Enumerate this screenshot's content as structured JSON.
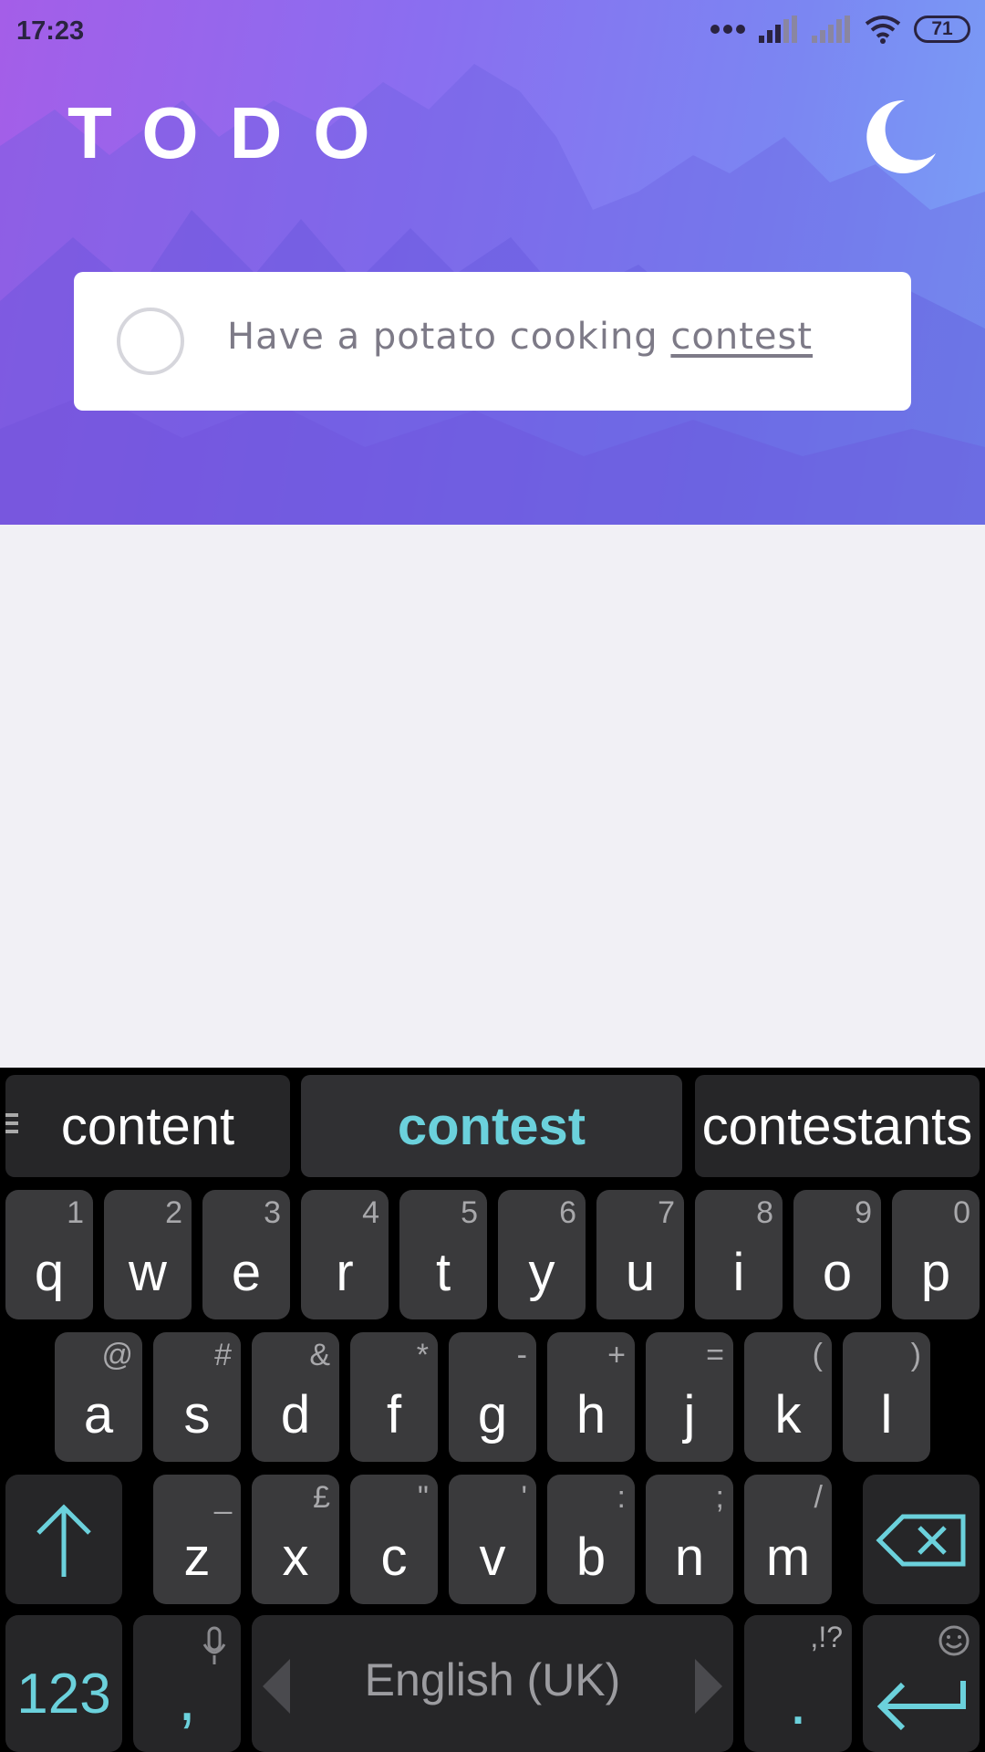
{
  "status_bar": {
    "time": "17:23",
    "battery": "71"
  },
  "app": {
    "title": "TODO"
  },
  "todo_input": {
    "text_before": "Have a potato cooking ",
    "text_underlined": "contest"
  },
  "keyboard": {
    "suggestions": [
      "content",
      "contest",
      "contestants"
    ],
    "row1": [
      {
        "key": "q",
        "alt": "1"
      },
      {
        "key": "w",
        "alt": "2"
      },
      {
        "key": "e",
        "alt": "3"
      },
      {
        "key": "r",
        "alt": "4"
      },
      {
        "key": "t",
        "alt": "5"
      },
      {
        "key": "y",
        "alt": "6"
      },
      {
        "key": "u",
        "alt": "7"
      },
      {
        "key": "i",
        "alt": "8"
      },
      {
        "key": "o",
        "alt": "9"
      },
      {
        "key": "p",
        "alt": "0"
      }
    ],
    "row2": [
      {
        "key": "a",
        "alt": "@"
      },
      {
        "key": "s",
        "alt": "#"
      },
      {
        "key": "d",
        "alt": "&"
      },
      {
        "key": "f",
        "alt": "*"
      },
      {
        "key": "g",
        "alt": "-"
      },
      {
        "key": "h",
        "alt": "+"
      },
      {
        "key": "j",
        "alt": "="
      },
      {
        "key": "k",
        "alt": "("
      },
      {
        "key": "l",
        "alt": ")"
      }
    ],
    "row3": [
      {
        "key": "z",
        "alt": "_"
      },
      {
        "key": "x",
        "alt": "£"
      },
      {
        "key": "c",
        "alt": "\""
      },
      {
        "key": "v",
        "alt": "'"
      },
      {
        "key": "b",
        "alt": ":"
      },
      {
        "key": "n",
        "alt": ";"
      },
      {
        "key": "m",
        "alt": "/"
      }
    ],
    "numbers_key": "123",
    "comma_key": ",",
    "space_label": "English (UK)",
    "period_key": ".",
    "period_alt": ",!?"
  },
  "colors": {
    "accent": "#6bd1dc",
    "gradient_start": "#a45ee8",
    "gradient_end": "#79a0f6"
  }
}
